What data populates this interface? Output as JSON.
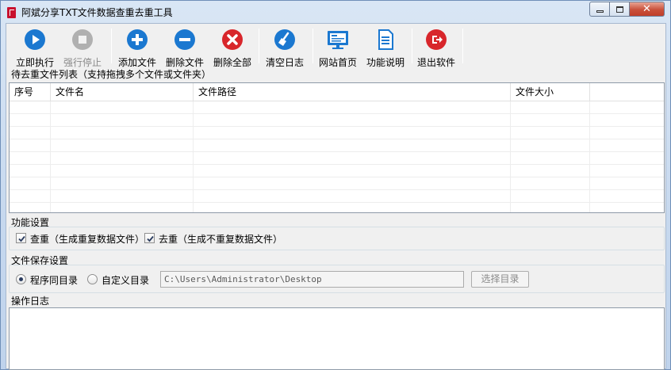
{
  "window": {
    "title": "阿斌分享TXT文件数据查重去重工具"
  },
  "toolbar": {
    "run": "立即执行",
    "stop": "强行停止",
    "add": "添加文件",
    "remove": "删除文件",
    "remove_all": "删除全部",
    "clear_log": "清空日志",
    "website": "网站首页",
    "help": "功能说明",
    "exit": "退出软件"
  },
  "file_list": {
    "label": "待去重文件列表（支持拖拽多个文件或文件夹）",
    "columns": [
      "序号",
      "文件名",
      "文件路径",
      "文件大小"
    ],
    "rows": []
  },
  "features": {
    "label": "功能设置",
    "check_dup": {
      "label": "查重（生成重复数据文件）",
      "checked": true
    },
    "dedup": {
      "label": "去重（生成不重复数据文件）",
      "checked": true
    }
  },
  "save": {
    "label": "文件保存设置",
    "same_dir": {
      "label": "程序同目录",
      "selected": true
    },
    "custom_dir": {
      "label": "自定义目录",
      "selected": false
    },
    "path_value": "C:\\Users\\Administrator\\Desktop",
    "choose_button": "选择目录"
  },
  "log": {
    "label": "操作日志"
  },
  "colors": {
    "play_blue": "#1b78d0",
    "danger_red": "#d8262b",
    "disabled_gray": "#a8a8a8"
  }
}
